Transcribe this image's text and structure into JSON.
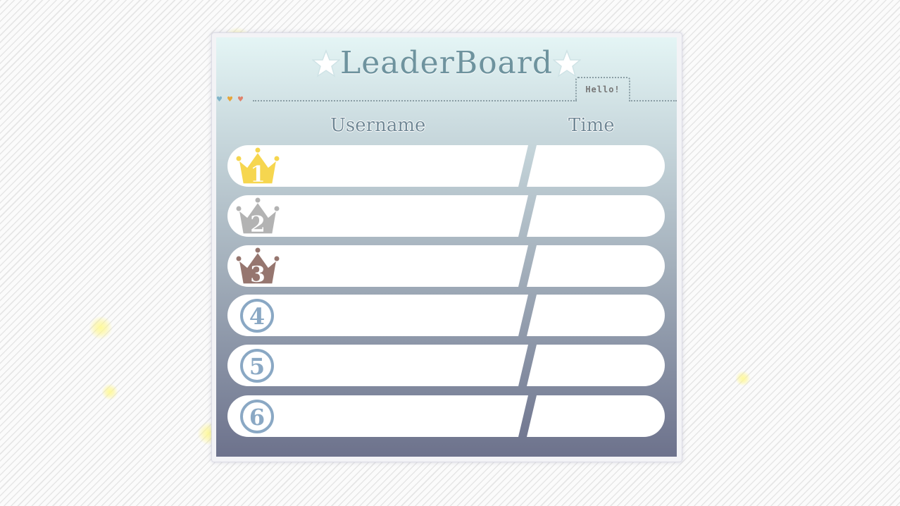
{
  "title": "LeaderBoard",
  "tab_label": "Hello!",
  "headers": {
    "username": "Username",
    "time": "Time"
  },
  "colors": {
    "title": "#6e939e",
    "gold_crown": "#f6d64f",
    "silver_crown": "#b3b3b3",
    "bronze_crown": "#96766f",
    "rank_circle": "#8aa8c4"
  },
  "rows": [
    {
      "rank": "1",
      "icon": "gold-crown-icon",
      "username": "",
      "time": ""
    },
    {
      "rank": "2",
      "icon": "silver-crown-icon",
      "username": "",
      "time": ""
    },
    {
      "rank": "3",
      "icon": "bronze-crown-icon",
      "username": "",
      "time": ""
    },
    {
      "rank": "4",
      "icon": "rank-circle-icon",
      "username": "",
      "time": ""
    },
    {
      "rank": "5",
      "icon": "rank-circle-icon",
      "username": "",
      "time": ""
    },
    {
      "rank": "6",
      "icon": "rank-circle-icon",
      "username": "",
      "time": ""
    }
  ]
}
